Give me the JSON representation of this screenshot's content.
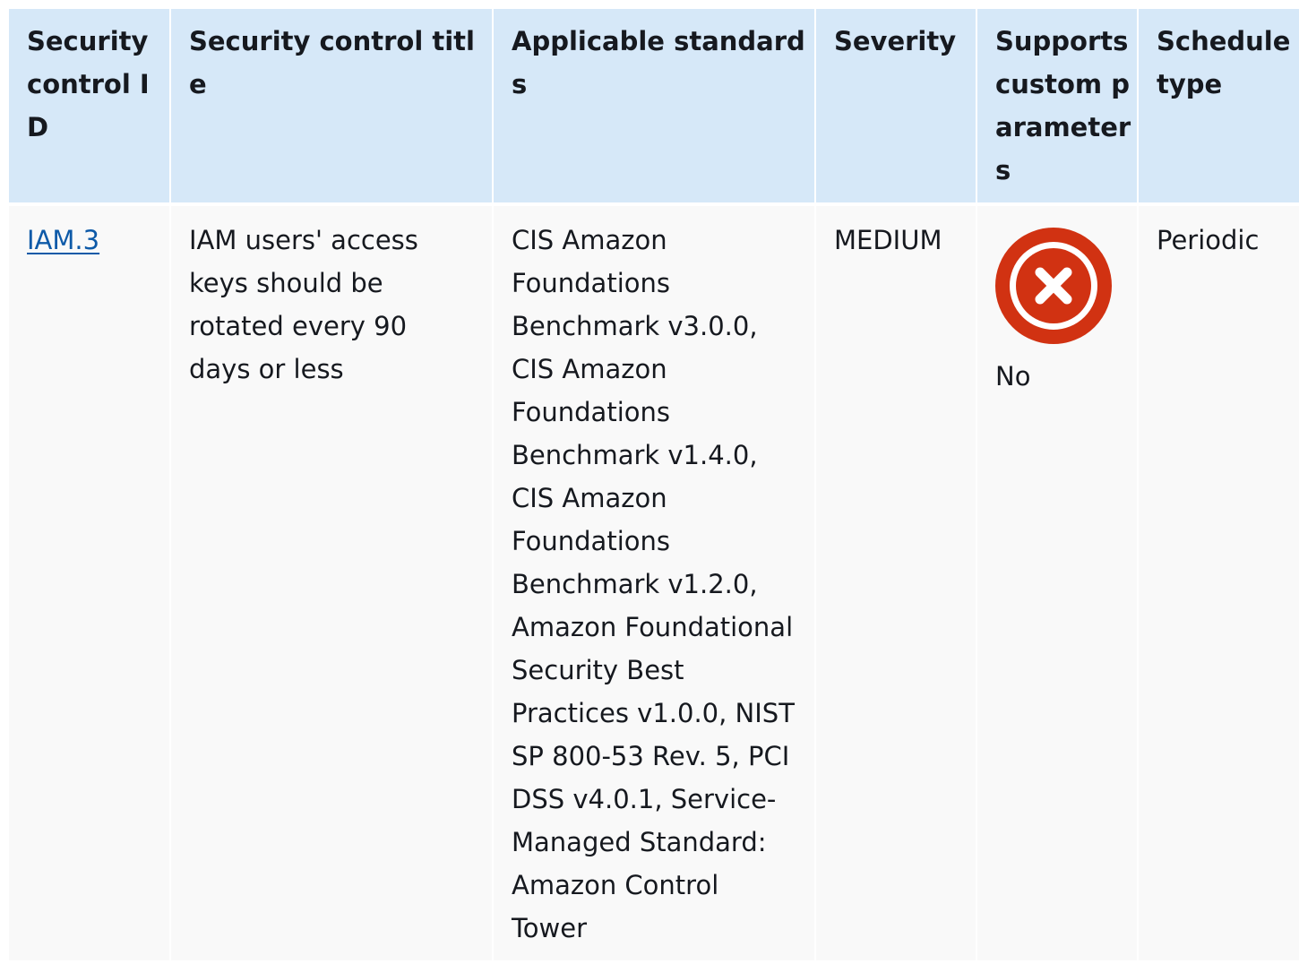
{
  "table": {
    "headers": [
      "Security control ID",
      "Security control title",
      "Applicable standards",
      "Severity",
      "Supports custom parameters",
      "Schedule type"
    ],
    "row": {
      "control_id": "IAM.3",
      "title": "IAM users' access keys should be rotated every 90 days or less",
      "standards": "CIS Amazon Foundations Benchmark v3.0.0, CIS Amazon Foundations Benchmark v1.4.0, CIS Amazon Foundations Benchmark v1.2.0, Amazon Foundational Security Best Practices v1.0.0, NIST SP 800-53 Rev. 5, PCI DSS v4.0.1, Service-Managed Standard: Amazon Control Tower",
      "severity": "MEDIUM",
      "custom_parameters": {
        "icon": "x-circle-icon",
        "label": "No"
      },
      "schedule_type": "Periodic"
    }
  },
  "colors": {
    "header_bg": "#d6e8f8",
    "cell_bg": "#f9f9f9",
    "link": "#0e5aa8",
    "no_icon": "#d13212"
  }
}
